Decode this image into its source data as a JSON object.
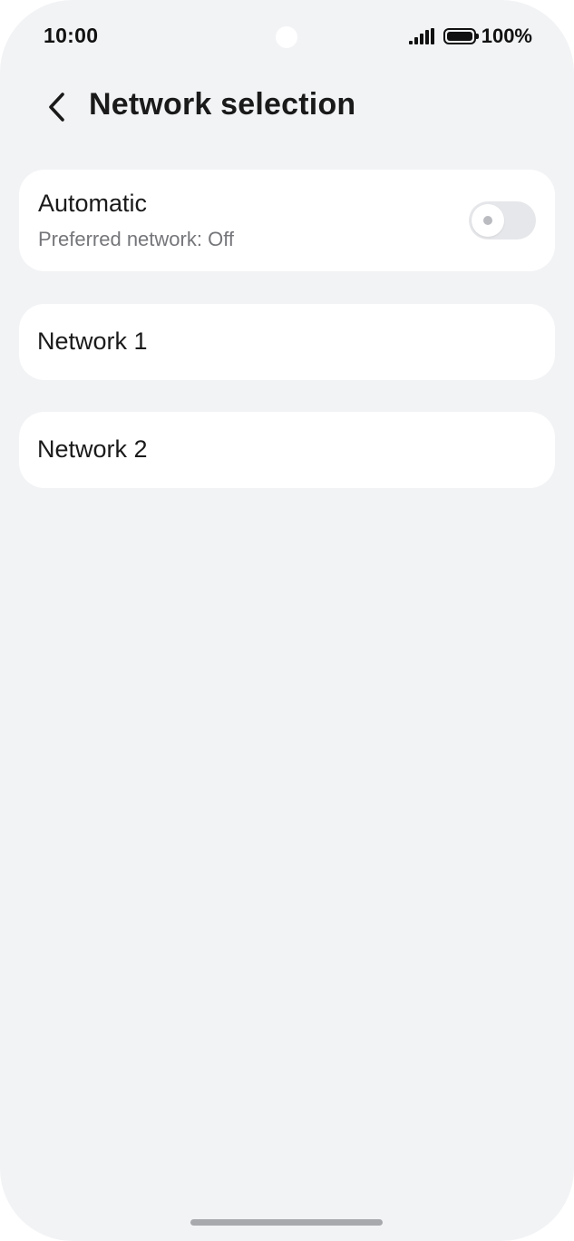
{
  "status_bar": {
    "time": "10:00",
    "battery": "100%",
    "icons": [
      "signal-icon",
      "battery-icon"
    ]
  },
  "header": {
    "title": "Network selection",
    "back_icon": "chevron-left-icon"
  },
  "automatic": {
    "title": "Automatic",
    "subtitle": "Preferred network: Off",
    "toggle_on": false
  },
  "networks": [
    {
      "label": "Network 1"
    },
    {
      "label": "Network 2"
    }
  ],
  "colors": {
    "background": "#f2f3f5",
    "card": "#ffffff",
    "text_primary": "#1a1a1a",
    "text_secondary": "#75767a",
    "toggle_off": "#e6e7ea"
  }
}
